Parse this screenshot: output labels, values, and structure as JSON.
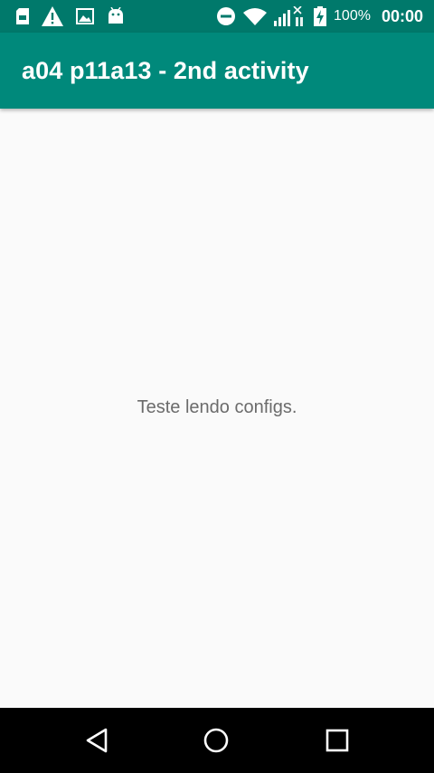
{
  "status_bar": {
    "battery_percent": "100%",
    "clock": "00:00",
    "icons_left": [
      "sd-card-icon",
      "warning-icon",
      "image-icon",
      "android-icon"
    ],
    "icons_right": [
      "do-not-disturb-icon",
      "wifi-icon",
      "signal-icon",
      "battery-charging-icon"
    ]
  },
  "app_bar": {
    "title": "a04 p11a13 - 2nd activity"
  },
  "content": {
    "message": "Teste lendo configs."
  },
  "nav_bar": {
    "buttons": [
      "back",
      "home",
      "recents"
    ]
  },
  "colors": {
    "status_bar": "#00796b",
    "app_bar": "#00897b",
    "background": "#fafafa",
    "text": "#6b6b6b",
    "nav_bar": "#000000"
  }
}
